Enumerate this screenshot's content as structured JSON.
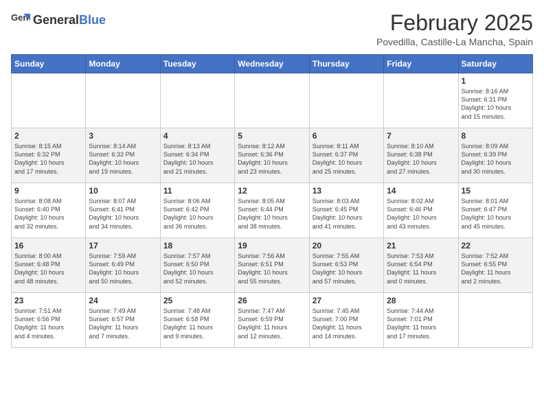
{
  "header": {
    "logo_general": "General",
    "logo_blue": "Blue",
    "title": "February 2025",
    "subtitle": "Povedilla, Castille-La Mancha, Spain"
  },
  "days_of_week": [
    "Sunday",
    "Monday",
    "Tuesday",
    "Wednesday",
    "Thursday",
    "Friday",
    "Saturday"
  ],
  "weeks": [
    [
      {
        "day": "",
        "info": ""
      },
      {
        "day": "",
        "info": ""
      },
      {
        "day": "",
        "info": ""
      },
      {
        "day": "",
        "info": ""
      },
      {
        "day": "",
        "info": ""
      },
      {
        "day": "",
        "info": ""
      },
      {
        "day": "1",
        "info": "Sunrise: 8:16 AM\nSunset: 6:31 PM\nDaylight: 10 hours\nand 15 minutes."
      }
    ],
    [
      {
        "day": "2",
        "info": "Sunrise: 8:15 AM\nSunset: 6:32 PM\nDaylight: 10 hours\nand 17 minutes."
      },
      {
        "day": "3",
        "info": "Sunrise: 8:14 AM\nSunset: 6:33 PM\nDaylight: 10 hours\nand 19 minutes."
      },
      {
        "day": "4",
        "info": "Sunrise: 8:13 AM\nSunset: 6:34 PM\nDaylight: 10 hours\nand 21 minutes."
      },
      {
        "day": "5",
        "info": "Sunrise: 8:12 AM\nSunset: 6:36 PM\nDaylight: 10 hours\nand 23 minutes."
      },
      {
        "day": "6",
        "info": "Sunrise: 8:11 AM\nSunset: 6:37 PM\nDaylight: 10 hours\nand 25 minutes."
      },
      {
        "day": "7",
        "info": "Sunrise: 8:10 AM\nSunset: 6:38 PM\nDaylight: 10 hours\nand 27 minutes."
      },
      {
        "day": "8",
        "info": "Sunrise: 8:09 AM\nSunset: 6:39 PM\nDaylight: 10 hours\nand 30 minutes."
      }
    ],
    [
      {
        "day": "9",
        "info": "Sunrise: 8:08 AM\nSunset: 6:40 PM\nDaylight: 10 hours\nand 32 minutes."
      },
      {
        "day": "10",
        "info": "Sunrise: 8:07 AM\nSunset: 6:41 PM\nDaylight: 10 hours\nand 34 minutes."
      },
      {
        "day": "11",
        "info": "Sunrise: 8:06 AM\nSunset: 6:42 PM\nDaylight: 10 hours\nand 36 minutes."
      },
      {
        "day": "12",
        "info": "Sunrise: 8:05 AM\nSunset: 6:44 PM\nDaylight: 10 hours\nand 38 minutes."
      },
      {
        "day": "13",
        "info": "Sunrise: 8:03 AM\nSunset: 6:45 PM\nDaylight: 10 hours\nand 41 minutes."
      },
      {
        "day": "14",
        "info": "Sunrise: 8:02 AM\nSunset: 6:46 PM\nDaylight: 10 hours\nand 43 minutes."
      },
      {
        "day": "15",
        "info": "Sunrise: 8:01 AM\nSunset: 6:47 PM\nDaylight: 10 hours\nand 45 minutes."
      }
    ],
    [
      {
        "day": "16",
        "info": "Sunrise: 8:00 AM\nSunset: 6:48 PM\nDaylight: 10 hours\nand 48 minutes."
      },
      {
        "day": "17",
        "info": "Sunrise: 7:59 AM\nSunset: 6:49 PM\nDaylight: 10 hours\nand 50 minutes."
      },
      {
        "day": "18",
        "info": "Sunrise: 7:57 AM\nSunset: 6:50 PM\nDaylight: 10 hours\nand 52 minutes."
      },
      {
        "day": "19",
        "info": "Sunrise: 7:56 AM\nSunset: 6:51 PM\nDaylight: 10 hours\nand 55 minutes."
      },
      {
        "day": "20",
        "info": "Sunrise: 7:55 AM\nSunset: 6:53 PM\nDaylight: 10 hours\nand 57 minutes."
      },
      {
        "day": "21",
        "info": "Sunrise: 7:53 AM\nSunset: 6:54 PM\nDaylight: 11 hours\nand 0 minutes."
      },
      {
        "day": "22",
        "info": "Sunrise: 7:52 AM\nSunset: 6:55 PM\nDaylight: 11 hours\nand 2 minutes."
      }
    ],
    [
      {
        "day": "23",
        "info": "Sunrise: 7:51 AM\nSunset: 6:56 PM\nDaylight: 11 hours\nand 4 minutes."
      },
      {
        "day": "24",
        "info": "Sunrise: 7:49 AM\nSunset: 6:57 PM\nDaylight: 11 hours\nand 7 minutes."
      },
      {
        "day": "25",
        "info": "Sunrise: 7:48 AM\nSunset: 6:58 PM\nDaylight: 11 hours\nand 9 minutes."
      },
      {
        "day": "26",
        "info": "Sunrise: 7:47 AM\nSunset: 6:59 PM\nDaylight: 11 hours\nand 12 minutes."
      },
      {
        "day": "27",
        "info": "Sunrise: 7:45 AM\nSunset: 7:00 PM\nDaylight: 11 hours\nand 14 minutes."
      },
      {
        "day": "28",
        "info": "Sunrise: 7:44 AM\nSunset: 7:01 PM\nDaylight: 11 hours\nand 17 minutes."
      },
      {
        "day": "",
        "info": ""
      }
    ]
  ]
}
